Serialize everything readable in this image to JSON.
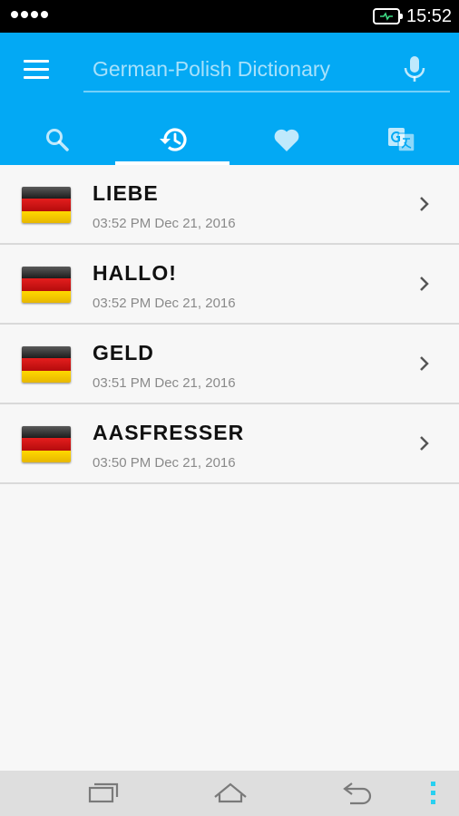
{
  "status_bar": {
    "time": "15:52"
  },
  "header": {
    "search_placeholder": "German-Polish Dictionary",
    "tabs": [
      {
        "icon": "search-icon",
        "active": false
      },
      {
        "icon": "history-icon",
        "active": true
      },
      {
        "icon": "heart-icon",
        "active": false
      },
      {
        "icon": "translate-icon",
        "active": false
      }
    ]
  },
  "history": [
    {
      "word": "LIEBE",
      "time": "03:52 PM Dec 21, 2016",
      "flag": "german-flag-icon"
    },
    {
      "word": "HALLO!",
      "time": "03:52 PM Dec 21, 2016",
      "flag": "german-flag-icon"
    },
    {
      "word": "GELD",
      "time": "03:51 PM Dec 21, 2016",
      "flag": "german-flag-icon"
    },
    {
      "word": "AASFRESSER",
      "time": "03:50 PM Dec 21, 2016",
      "flag": "german-flag-icon"
    }
  ],
  "colors": {
    "app_bar": "#03a9f4",
    "status_bar": "#000000",
    "nav_bar": "#dedede",
    "overflow_accent": "#29d0f0"
  }
}
